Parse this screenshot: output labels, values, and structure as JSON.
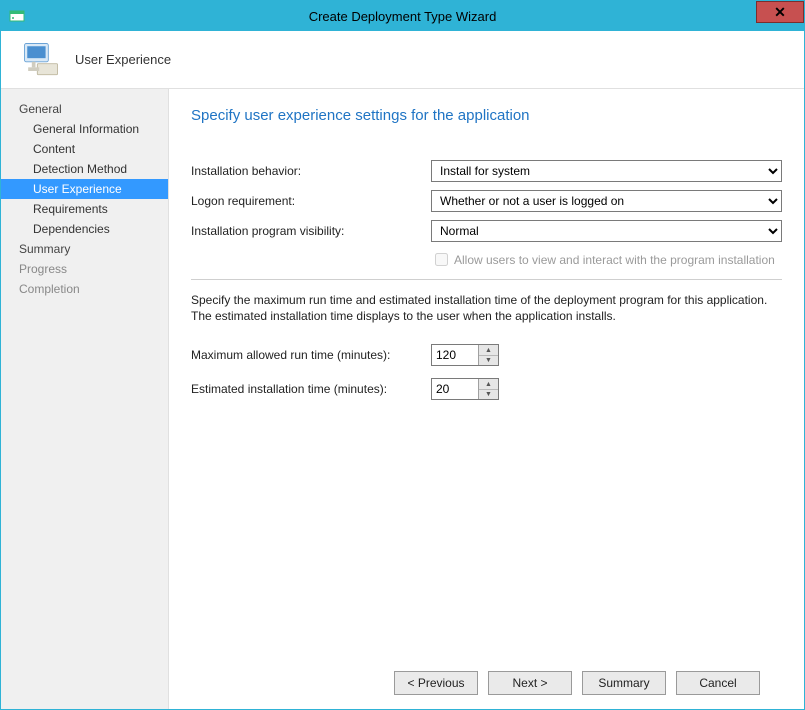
{
  "window": {
    "title": "Create Deployment Type Wizard"
  },
  "header": {
    "title": "User Experience"
  },
  "sidebar": {
    "items": [
      {
        "label": "General",
        "kind": "top"
      },
      {
        "label": "General Information",
        "kind": "sub"
      },
      {
        "label": "Content",
        "kind": "sub"
      },
      {
        "label": "Detection Method",
        "kind": "sub"
      },
      {
        "label": "User Experience",
        "kind": "sub",
        "selected": true
      },
      {
        "label": "Requirements",
        "kind": "sub"
      },
      {
        "label": "Dependencies",
        "kind": "sub"
      },
      {
        "label": "Summary",
        "kind": "top"
      },
      {
        "label": "Progress",
        "kind": "top",
        "muted": true
      },
      {
        "label": "Completion",
        "kind": "top",
        "muted": true
      }
    ]
  },
  "main": {
    "heading": "Specify user experience settings for the application",
    "installation_behavior_label": "Installation behavior:",
    "installation_behavior_value": "Install for system",
    "logon_requirement_label": "Logon requirement:",
    "logon_requirement_value": "Whether or not a user is logged on",
    "visibility_label": "Installation program visibility:",
    "visibility_value": "Normal",
    "allow_interact_label": "Allow users to view and interact with the program installation",
    "allow_interact_checked": false,
    "help_text": "Specify the maximum run time and estimated installation time of the deployment program for this application. The estimated installation time displays to the user when the application installs.",
    "max_runtime_label": "Maximum allowed run time (minutes):",
    "max_runtime_value": "120",
    "est_install_label": "Estimated installation time (minutes):",
    "est_install_value": "20"
  },
  "footer": {
    "previous": "< Previous",
    "next": "Next >",
    "summary": "Summary",
    "cancel": "Cancel"
  }
}
